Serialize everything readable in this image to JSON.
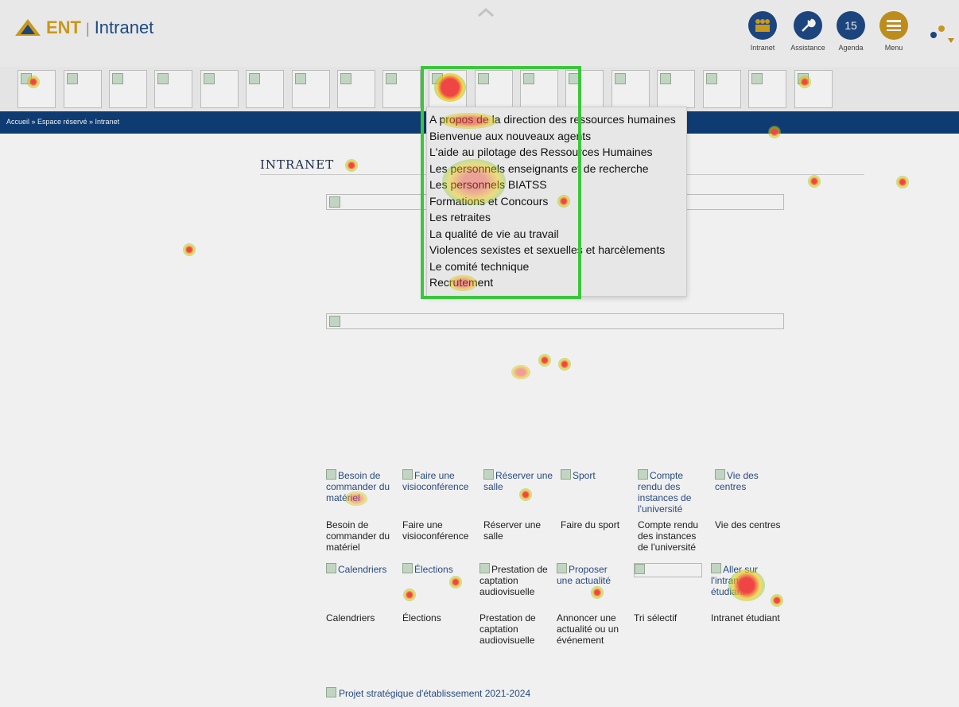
{
  "header": {
    "logo_ent": "ENT",
    "logo_sep": "|",
    "logo_title": "Intranet",
    "apps": [
      {
        "label": "Intranet",
        "color": "#1e4a86",
        "icon": "people-icon"
      },
      {
        "label": "Assistance",
        "color": "#1e4a86",
        "icon": "wrench-icon"
      },
      {
        "label": "Agenda",
        "color": "#1e4a86",
        "icon": "calendar-icon",
        "day": "15"
      },
      {
        "label": "Menu",
        "color": "#c9961e",
        "icon": "menu-icon"
      }
    ]
  },
  "breadcrumb": "Accueil » Espace réservé » Intranet",
  "page_title": "INTRANET",
  "dropdown": {
    "items": [
      "A propos de la direction des ressources humaines",
      "Bienvenue aux nouveaux agents",
      "L'aide au pilotage des Ressources Humaines",
      "Les personnels enseignants et de recherche",
      "Les personnels BIATSS",
      "Formations et Concours",
      "Les retraites",
      "La qualité de vie au travail",
      "Violences sexistes et sexuelles et harcèlements",
      "Le comité technique",
      "Recrutement"
    ]
  },
  "tiles_row1": [
    {
      "alt": "Besoin de commander du matériel",
      "caption": "Besoin de commander du matériel"
    },
    {
      "alt": "Faire une visioconférence",
      "caption": "Faire une visioconférence"
    },
    {
      "alt": "Réserver une salle",
      "caption": "Réserver une salle"
    },
    {
      "alt": "Sport",
      "caption": "Faire du sport"
    },
    {
      "alt": "Compte rendu des instances de l'université",
      "caption": "Compte rendu des instances de l'université"
    },
    {
      "alt": "Vie des centres",
      "caption": "Vie des centres"
    }
  ],
  "tiles_row2": [
    {
      "alt": "Calendriers",
      "caption": "Calendriers"
    },
    {
      "alt": "Élections",
      "caption": "Élections"
    },
    {
      "alt": "Prestation de captation audiovisuelle",
      "caption": "Prestation de captation audiovisuelle"
    },
    {
      "alt": "Proposer une actualité",
      "caption": "Annoncer une actualité ou un événement"
    },
    {
      "alt": "",
      "caption": "Tri sélectif"
    },
    {
      "alt": "Aller sur l'intranet étudiant",
      "caption": "Intranet étudiant"
    }
  ],
  "footer_link": "Projet stratégique d'établissement 2021-2024"
}
